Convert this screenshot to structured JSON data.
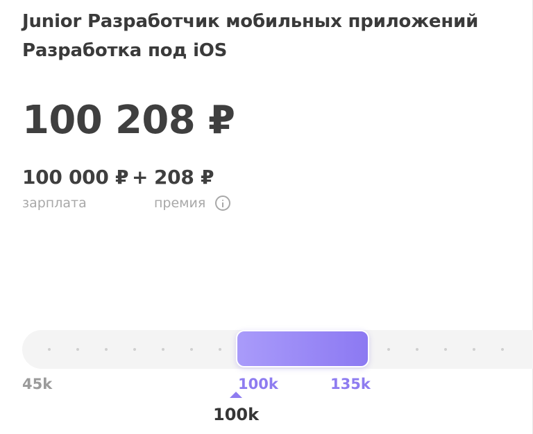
{
  "header": {
    "position_title": "Junior Разработчик мобильных приложений",
    "specialization": "Разработка под iOS"
  },
  "compensation": {
    "total": "100 208 ₽",
    "salary_amount": "100 000 ₽",
    "plus_sign": "+",
    "bonus_amount": "208 ₽",
    "salary_caption": "зарплата",
    "bonus_caption": "премия",
    "bonus_info_icon": "info-icon"
  },
  "salary_range": {
    "scale_min_label": "45k",
    "range_from_label": "100k",
    "range_to_label": "135k",
    "current_value_label": "100k",
    "accent_color": "#8e7cf0",
    "range_fill_start": "#a99bfa",
    "range_fill_end": "#8c79f2"
  }
}
